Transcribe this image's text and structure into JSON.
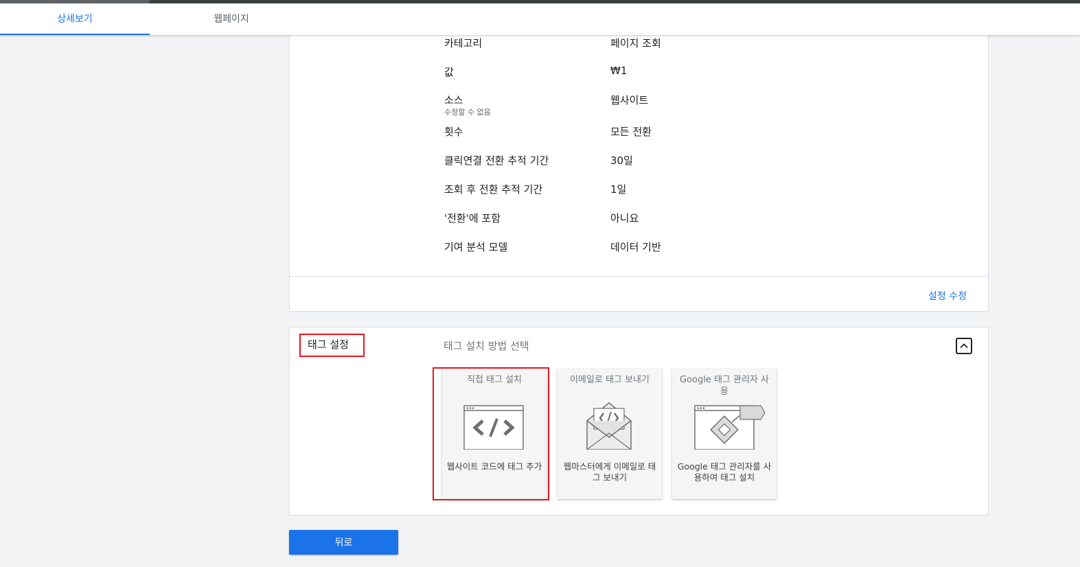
{
  "tabs": [
    {
      "label": "상세보기",
      "active": true
    },
    {
      "label": "웹페이지",
      "active": false
    }
  ],
  "settings": {
    "rows": [
      {
        "label": "카테고리",
        "value": "페이지 조회"
      },
      {
        "label": "값",
        "value": "₩1"
      },
      {
        "label": "소스",
        "sub": "수정할 수 없음",
        "value": "웹사이트"
      },
      {
        "label": "횟수",
        "value": "모든 전환"
      },
      {
        "label": "클릭연결 전환 추적 기간",
        "value": "30일"
      },
      {
        "label": "조회 후 전환 추적 기간",
        "value": "1일"
      },
      {
        "label": "'전환'에 포함",
        "value": "아니요"
      },
      {
        "label": "기여 분석 모델",
        "value": "데이터 기반"
      }
    ],
    "edit_label": "설정 수정"
  },
  "tag_setup": {
    "title": "태그 설정",
    "subtitle": "태그 설치 방법 선택",
    "collapse_icon": "chevron-up-icon",
    "options": [
      {
        "title": "직접 태그 설치",
        "description": "웹사이트 코드에 태그 추가",
        "icon": "browser-code-icon",
        "selected": true
      },
      {
        "title": "이메일로 태그 보내기",
        "description": "웹마스터에게 이메일로 태그 보내기",
        "icon": "envelope-code-icon",
        "selected": false
      },
      {
        "title": "Google 태그 관리자 사용",
        "description": "Google 태그 관리자를 사용하여 태그 설치",
        "icon": "tag-manager-icon",
        "selected": false
      }
    ]
  },
  "back_label": "뒤로",
  "colors": {
    "accent": "#1a73e8",
    "highlight": "#e8141b",
    "background": "#f1f3f4"
  }
}
